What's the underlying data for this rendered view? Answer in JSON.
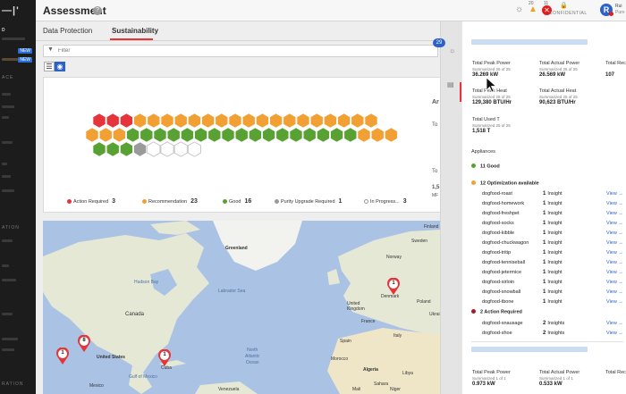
{
  "sidebar": {
    "logo": "—|'",
    "items": [
      "D",
      "ACE",
      "ATION",
      "RATION"
    ],
    "badges": [
      "NEW",
      "NEW"
    ]
  },
  "header": {
    "title": "Assessment",
    "help_icon": "question-circle-icon",
    "alerts": [
      {
        "icon": "bulb-icon",
        "count": ""
      },
      {
        "icon": "warning-icon",
        "count": "20"
      },
      {
        "icon": "critical-icon",
        "count": "11"
      }
    ],
    "confidential_label": "CONFIDENTIAL",
    "avatar_initial": "R",
    "user_name": "Rui",
    "user_org": "Pure"
  },
  "tabs": [
    {
      "label": "Data Protection",
      "active": false
    },
    {
      "label": "Sustainability",
      "active": true
    }
  ],
  "filter": {
    "placeholder": "Filter"
  },
  "summary_card": {
    "legend": [
      {
        "label": "Action Required",
        "count": "3",
        "color": "#e5343a"
      },
      {
        "label": "Recommendation",
        "count": "23",
        "color": "#f2a033"
      },
      {
        "label": "Good",
        "count": "16",
        "color": "#5aa133"
      },
      {
        "label": "Purity Upgrade Required",
        "count": "1",
        "color": "#9a9a9a"
      },
      {
        "label": "In Progress...",
        "count": "3",
        "color": "#ffffff"
      }
    ],
    "right_labels": [
      "Ar",
      "To",
      "To",
      "1,5",
      "MF"
    ]
  },
  "map": {
    "labels": {
      "greenland": "Greenland",
      "hudson": "Hudson Bay",
      "labrador": "Labrador Sea",
      "canada": "Canada",
      "us": "United States",
      "mexico": "Mexico",
      "gulf": "Gulf of Mexico",
      "north_atlantic": "North\nAtlantic\nOcean",
      "sweden": "Sweden",
      "finland": "Finland",
      "norway": "Norway",
      "denmark": "Denmark",
      "uk": "United\nKingdom",
      "france": "France",
      "spain": "Spain",
      "algeria": "Algeria",
      "libya": "Libya",
      "mali": "Mali",
      "niger": "Niger",
      "morocco": "Morocco",
      "poland": "Poland",
      "ukraine": "Ukrai",
      "italy": "Italy",
      "sahara": "Sahara",
      "cuba": "Cuba",
      "venezuela": "Venezuela"
    },
    "pins": [
      "1",
      "8",
      "1",
      "1"
    ]
  },
  "strip": {
    "badge": "29"
  },
  "panel": {
    "stats_top": [
      {
        "label": "Total Peak Power",
        "sub": "Summarized 25 of 25",
        "value": "36.269 kW"
      },
      {
        "label": "Total Actual Power",
        "sub": "Summarized 25 of 25",
        "value": "26.569 kW"
      },
      {
        "label": "Total Rec",
        "sub": "",
        "value": "107"
      },
      {
        "label": "Total Peak Heat",
        "sub": "Summarized 25 of 25",
        "value": "129,380 BTU/Hr"
      },
      {
        "label": "Total Actual Heat",
        "sub": "Summarized 25 of 25",
        "value": "90,623 BTU/Hr"
      },
      {
        "label": "Total Used T",
        "sub": "Summarized 25 of 25",
        "value": "1,518 T"
      }
    ],
    "appliances_label": "Appliances",
    "good_group": {
      "label": "11 Good",
      "color": "#5aa133"
    },
    "opt_group": {
      "label": "12 Optimization available",
      "color": "#f2a033"
    },
    "opt_apps": [
      {
        "name": "dogfood-roast",
        "count": "1",
        "unit": "Insight",
        "view": "View →"
      },
      {
        "name": "dogfood-homework",
        "count": "1",
        "unit": "Insight",
        "view": "View →"
      },
      {
        "name": "dogfood-freshpet",
        "count": "1",
        "unit": "Insight",
        "view": "View →"
      },
      {
        "name": "dogfood-socks",
        "count": "1",
        "unit": "Insight",
        "view": "View →"
      },
      {
        "name": "dogfood-kibble",
        "count": "1",
        "unit": "Insight",
        "view": "View →"
      },
      {
        "name": "dogfood-chuckwagon",
        "count": "1",
        "unit": "Insight",
        "view": "View →"
      },
      {
        "name": "dogfood-tritip",
        "count": "1",
        "unit": "Insight",
        "view": "View →"
      },
      {
        "name": "dogfood-tenniseball",
        "count": "1",
        "unit": "Insight",
        "view": "View →"
      },
      {
        "name": "dogfood-jetermice",
        "count": "1",
        "unit": "Insight",
        "view": "View →"
      },
      {
        "name": "dogfood-sirloin",
        "count": "1",
        "unit": "Insight",
        "view": "View →"
      },
      {
        "name": "dogfood-snowball",
        "count": "1",
        "unit": "Insight",
        "view": "View →"
      },
      {
        "name": "dogfood-tbone",
        "count": "1",
        "unit": "Insight",
        "view": "View →"
      }
    ],
    "action_group": {
      "label": "2 Action Required",
      "color": "#a51d23"
    },
    "action_apps": [
      {
        "name": "dogfood-snausage",
        "count": "2",
        "unit": "Insights",
        "view": "View →"
      },
      {
        "name": "dogfood-shoe",
        "count": "2",
        "unit": "Insights",
        "view": "View →"
      }
    ],
    "stats_bottom": [
      {
        "label": "Total Peak Power",
        "sub": "Summarized 1 of 1",
        "value": "0.973 kW"
      },
      {
        "label": "Total Actual Power",
        "sub": "Summarized 1 of 1",
        "value": "0.533 kW"
      },
      {
        "label": "Total Rec",
        "sub": "",
        "value": ""
      }
    ]
  }
}
